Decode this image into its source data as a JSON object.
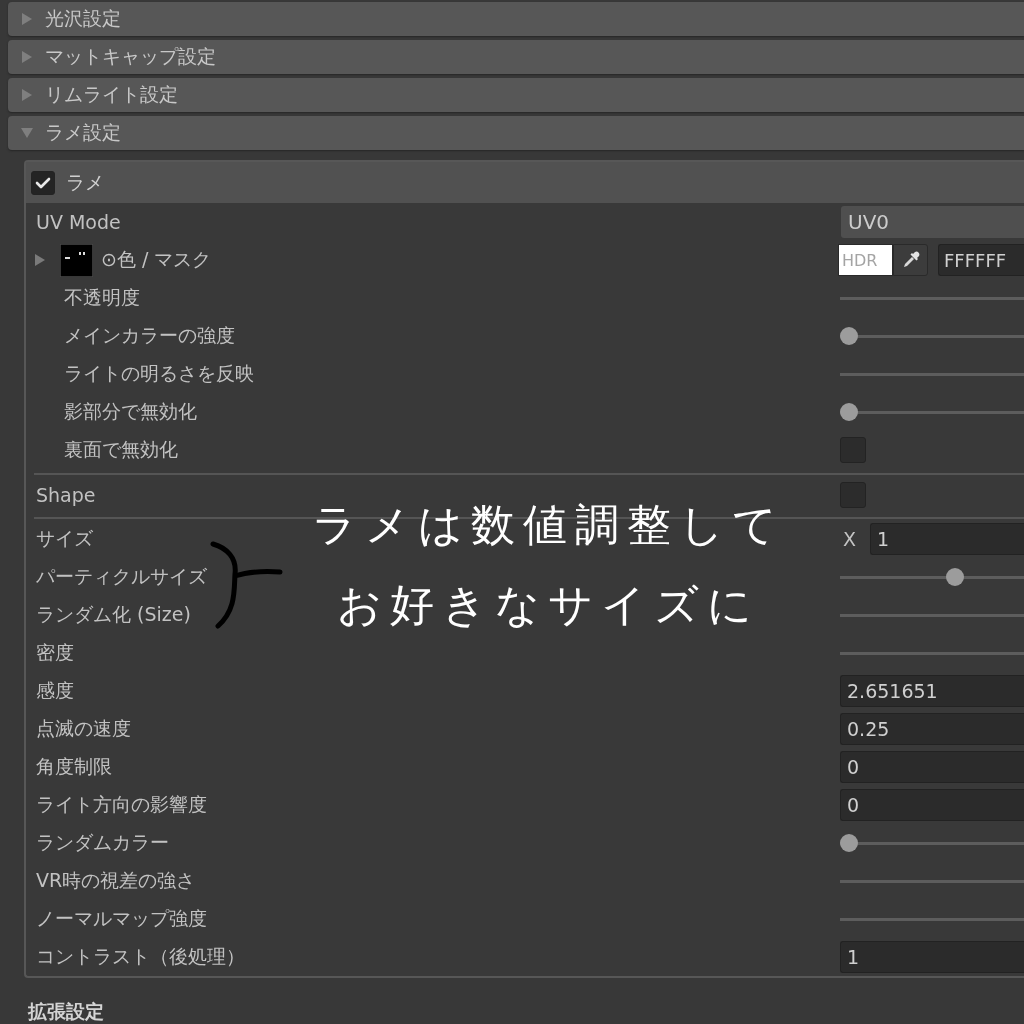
{
  "foldouts": [
    {
      "label": "光沢設定",
      "expanded": false
    },
    {
      "label": "マットキャップ設定",
      "expanded": false
    },
    {
      "label": "リムライト設定",
      "expanded": false
    },
    {
      "label": "ラメ設定",
      "expanded": true,
      "panel": {
        "toggle": {
          "label": "ラメ",
          "checked": true
        },
        "sections": [
          {
            "rows": [
              {
                "label": "UV Mode",
                "kind": "dropdown",
                "value": "UV0"
              },
              {
                "label": "⊙色 / マスク",
                "kind": "texture",
                "expanded": false,
                "color": "#ffffff",
                "swatch_text": "HDR",
                "value": "FFFFFF",
                "children": [
                  {
                    "label": "不透明度",
                    "kind": "track"
                  },
                  {
                    "label": "メインカラーの強度",
                    "kind": "slider",
                    "level": 0
                  },
                  {
                    "label": "ライトの明るさを反映",
                    "kind": "track"
                  },
                  {
                    "label": "影部分で無効化",
                    "kind": "slider",
                    "level": 0
                  },
                  {
                    "label": "裏面で無効化",
                    "kind": "checkbox",
                    "checked": false
                  }
                ]
              }
            ]
          },
          {
            "rows": [
              {
                "label": "Shape",
                "kind": "checkbox",
                "checked": false
              }
            ]
          },
          {
            "rows": [
              {
                "label": "サイズ",
                "kind": "vector",
                "axis": "X",
                "value": "1"
              },
              {
                "label": "パーティクルサイズ",
                "kind": "slider",
                "level": 0.64
              },
              {
                "label": "ランダム化 (Size)",
                "kind": "track"
              },
              {
                "label": "密度",
                "kind": "track"
              },
              {
                "label": "感度",
                "kind": "number",
                "value": "2.651651"
              },
              {
                "label": "点滅の速度",
                "kind": "number",
                "value": "0.25"
              },
              {
                "label": "角度制限",
                "kind": "number",
                "value": "0"
              },
              {
                "label": "ライト方向の影響度",
                "kind": "number",
                "value": "0"
              },
              {
                "label": "ランダムカラー",
                "kind": "slider",
                "level": 0
              },
              {
                "label": "VR時の視差の強さ",
                "kind": "track"
              },
              {
                "label": "ノーマルマップ強度",
                "kind": "track"
              },
              {
                "label": "コントラスト（後処理）",
                "kind": "number",
                "value": "1"
              }
            ]
          }
        ]
      }
    }
  ],
  "footer_heading": "拡張設定",
  "annotation": {
    "lines": [
      "ラメは数値調整して",
      "お好きなサイズに"
    ]
  }
}
